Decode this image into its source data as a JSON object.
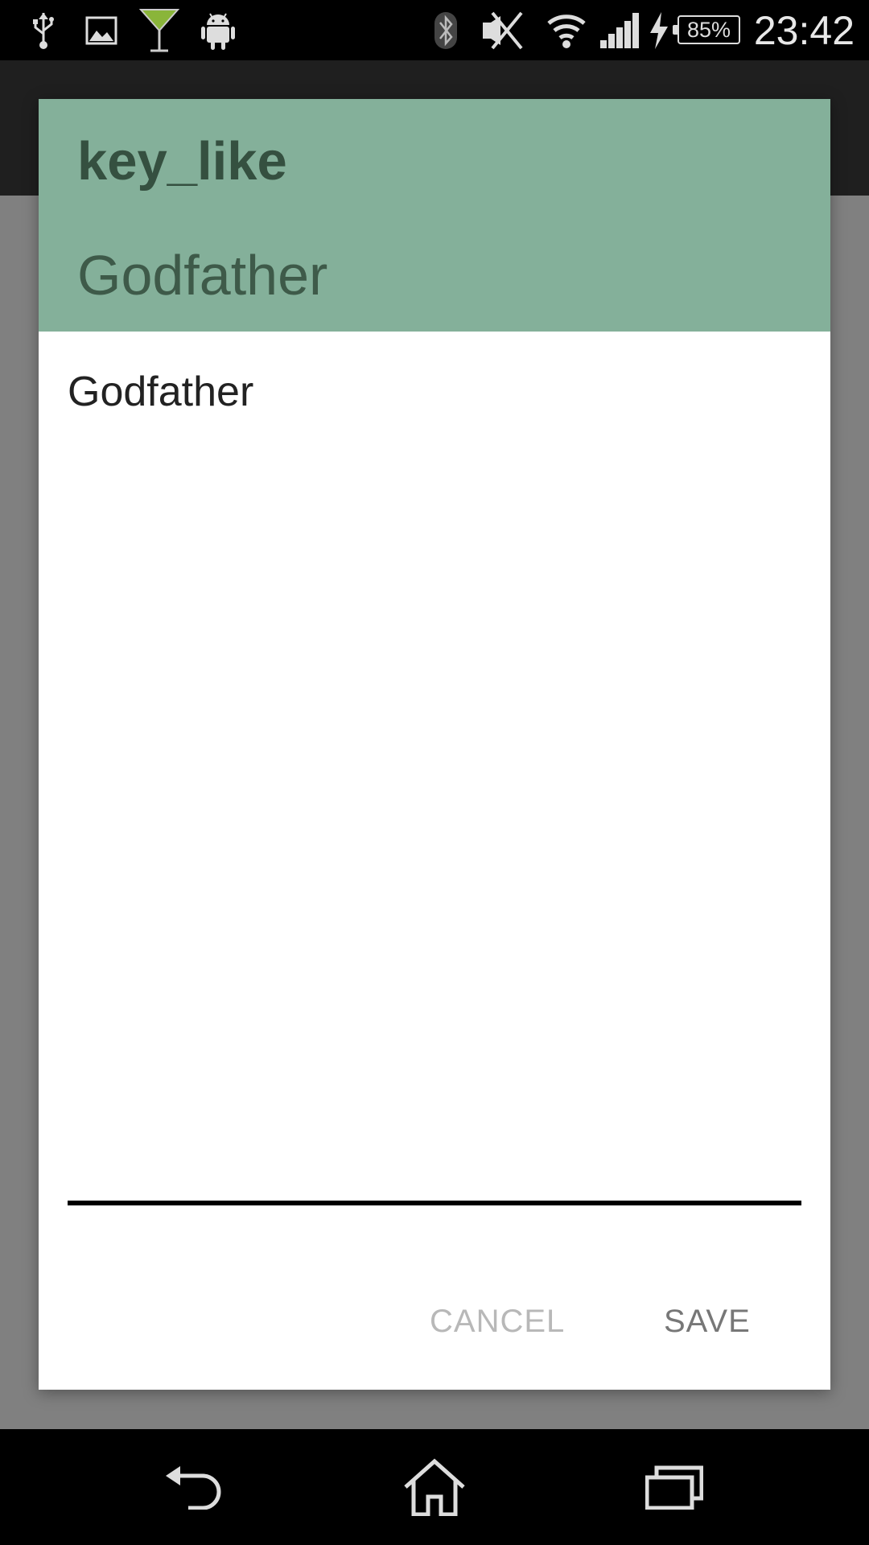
{
  "status_bar": {
    "battery_percent": "85%",
    "time": "23:42",
    "icons": [
      "usb-icon",
      "image-icon",
      "cocktail-icon",
      "android-icon",
      "bluetooth-icon",
      "nfc-off-icon",
      "wifi-icon",
      "signal-icon",
      "charging-icon",
      "battery-icon"
    ]
  },
  "dialog": {
    "title": "key_like",
    "subtitle": "Godfather",
    "body_text": "Godfather",
    "cancel_label": "CANCEL",
    "save_label": "SAVE",
    "header_color": "#84b09a"
  },
  "nav_bar": {
    "icons": [
      "back-icon",
      "home-icon",
      "recents-icon"
    ]
  }
}
